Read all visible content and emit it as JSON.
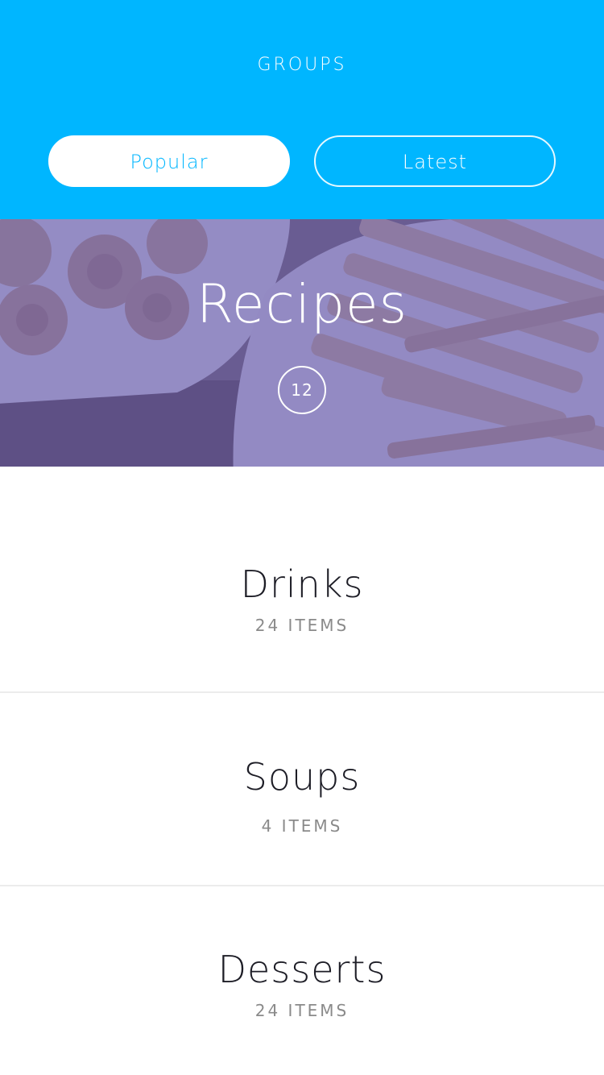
{
  "header": {
    "title": "GROUPS",
    "tabs": [
      {
        "label": "Popular",
        "selected": true
      },
      {
        "label": "Latest",
        "selected": false
      }
    ]
  },
  "hero": {
    "title": "Recipes",
    "count": "12"
  },
  "groups": [
    {
      "title": "Drinks",
      "count": "24 ITEMS"
    },
    {
      "title": "Soups",
      "count": "4 ITEMS"
    },
    {
      "title": "Desserts",
      "count": "24 ITEMS"
    }
  ],
  "colors": {
    "accent": "#00b6ff",
    "hero_overlay": "#6054aa",
    "title_text": "#1d1d26",
    "muted_text": "#8a8a8a",
    "divider": "#ececec"
  }
}
